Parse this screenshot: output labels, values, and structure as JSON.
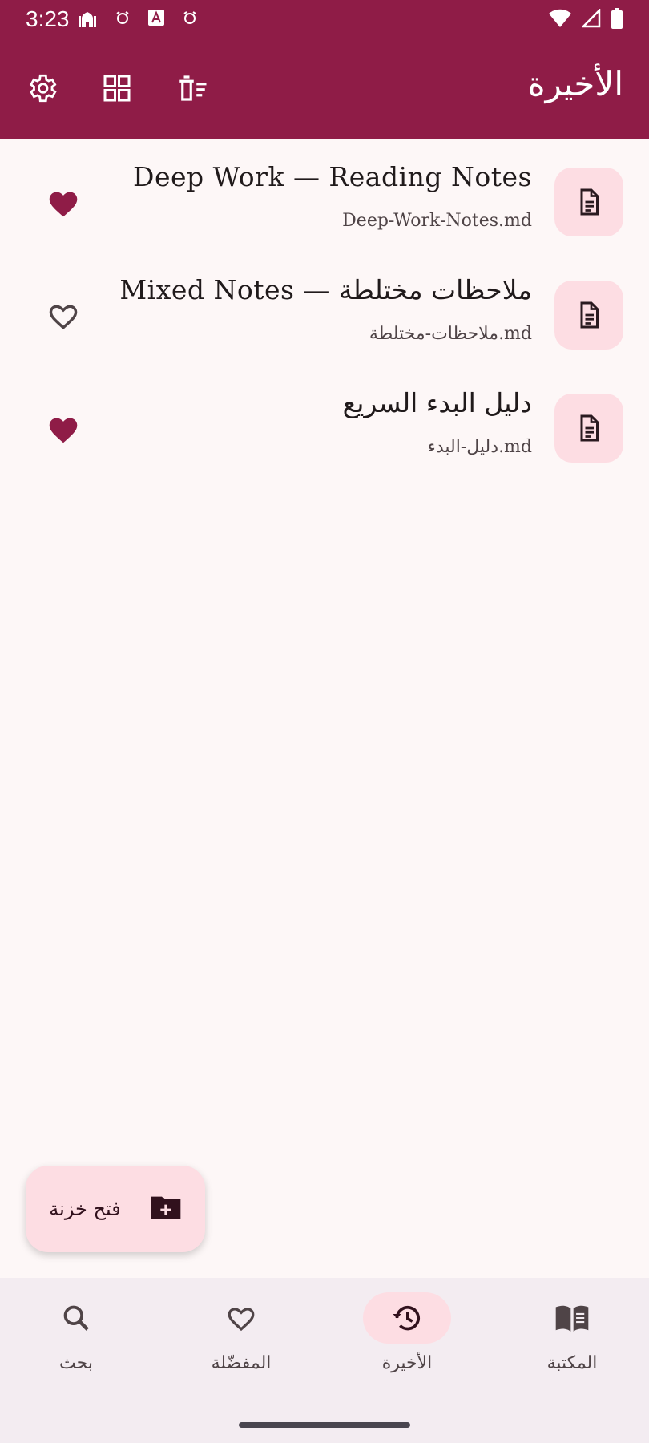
{
  "status_bar": {
    "time": "3:23",
    "left_icons": [
      "mosque-icon",
      "alarm-icon",
      "font-icon",
      "alarm-icon"
    ],
    "right_icons": [
      "wifi-icon",
      "signal-icon",
      "battery-icon"
    ]
  },
  "app_bar": {
    "title": "الأخيرة",
    "actions": [
      "settings-icon",
      "grid-view-icon",
      "clear-recent-icon"
    ]
  },
  "recent_files": [
    {
      "title": "Deep Work — Reading Notes",
      "filename": "Deep-Work-Notes.md",
      "favorite": true
    },
    {
      "title": "Mixed Notes — ملاحظات مختلطة",
      "filename": "ملاحظات-مختلطة.md",
      "favorite": false
    },
    {
      "title": "دليل البدء السريع",
      "filename": "دليل-البدء.md",
      "favorite": true
    }
  ],
  "fab": {
    "label": "فتح خزنة",
    "icon": "folder-add-icon"
  },
  "bottom_nav": {
    "items": [
      {
        "label": "بحث",
        "icon": "search-icon",
        "active": false
      },
      {
        "label": "المفضّلة",
        "icon": "heart-outline-icon",
        "active": false
      },
      {
        "label": "الأخيرة",
        "icon": "history-icon",
        "active": true
      },
      {
        "label": "المكتبة",
        "icon": "book-icon",
        "active": false
      }
    ]
  },
  "colors": {
    "primary": "#8f1c47",
    "surface": "#fdf7f7",
    "container": "#fddde3",
    "nav_background": "#f3ecf1"
  }
}
